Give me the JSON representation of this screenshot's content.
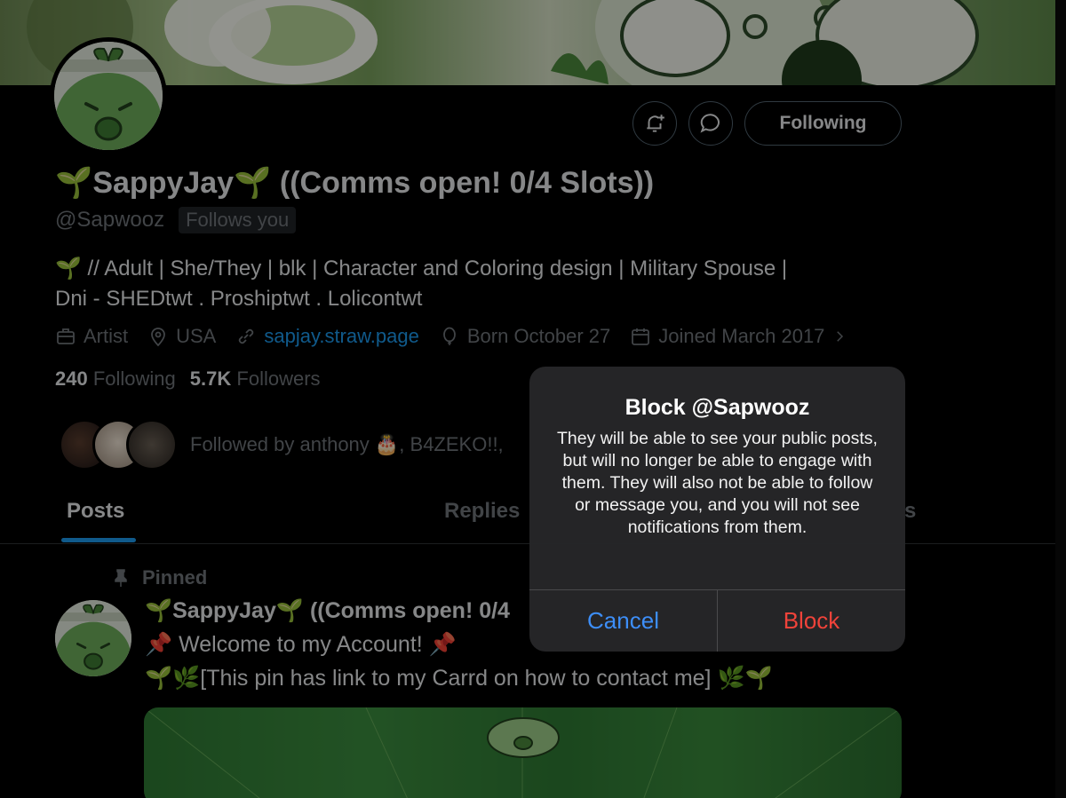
{
  "profile": {
    "display_name": "🌱SappyJay🌱 ((Comms open! 0/4 Slots))",
    "handle": "@Sapwooz",
    "follows_you": "Follows you",
    "bio_line1": "🌱 // Adult | She/They | blk | Character and Coloring design | Military Spouse |",
    "bio_line2": "Dni - SHEDtwt . Proshiptwt . Lolicontwt",
    "meta": {
      "profession": "Artist",
      "location": "USA",
      "website": "sapjay.straw.page",
      "birthday": "Born October 27",
      "joined": "Joined March 2017"
    },
    "following_count": "240",
    "following_label": "Following",
    "followers_count": "5.7K",
    "followers_label": "Followers",
    "followed_by": "Followed by anthony 🎂, B4ZEKO!!,",
    "follow_button": "Following"
  },
  "tabs": {
    "posts": "Posts",
    "replies": "Replies",
    "right_partial": "s"
  },
  "post": {
    "pinned": "Pinned",
    "author": "🌱SappyJay🌱 ((Comms open! 0/4",
    "line1": "📌 Welcome to my Account! 📌",
    "line2": "🌱🌿[This pin has link to my Carrd on how to contact me] 🌿🌱"
  },
  "dialog": {
    "title": "Block @Sapwooz",
    "message": "They will be able to see your public posts, but will no longer be able to engage with them. They will also not be able to follow or message you, and you will not see notifications from them.",
    "cancel": "Cancel",
    "confirm": "Block"
  },
  "colors": {
    "accent": "#1d9bf0",
    "destructive": "#f0433a",
    "ios_blue": "#3d8ef7"
  },
  "icons": [
    "bell-plus-icon",
    "message-icon",
    "briefcase-icon",
    "location-icon",
    "link-icon",
    "balloon-icon",
    "calendar-icon",
    "chevron-right-icon",
    "pin-icon"
  ]
}
